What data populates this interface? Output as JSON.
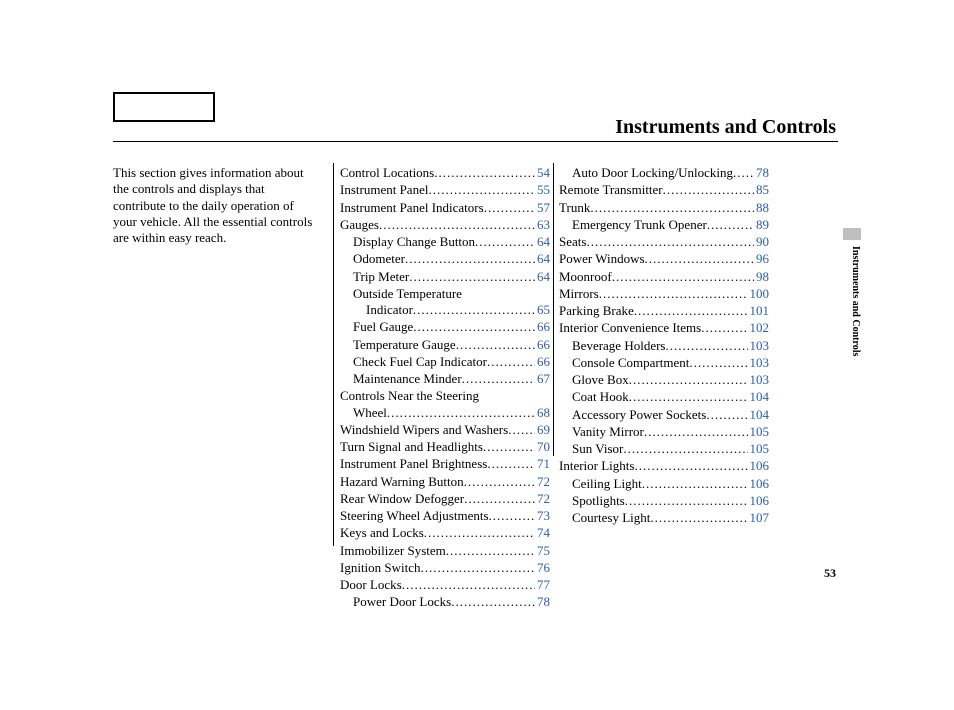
{
  "title": "Instruments and Controls",
  "intro": "This section gives information about the controls and displays that contribute to the daily operation of your vehicle. All the essential controls are within easy reach.",
  "side_tab": "Instruments and Controls",
  "page_number": "53",
  "col1": [
    {
      "label": "Control Locations",
      "page": "54",
      "indent": 0
    },
    {
      "label": "Instrument Panel",
      "page": "55",
      "indent": 0
    },
    {
      "label": "Instrument Panel Indicators",
      "page": "57",
      "indent": 0
    },
    {
      "label": "Gauges",
      "page": "63",
      "indent": 0
    },
    {
      "label": "Display Change Button",
      "page": "64",
      "indent": 1
    },
    {
      "label": "Odometer",
      "page": "64",
      "indent": 1
    },
    {
      "label": "Trip Meter",
      "page": "64",
      "indent": 1
    },
    {
      "label": "Outside Temperature",
      "wrap": "Indicator",
      "page": "65",
      "indent": 1
    },
    {
      "label": "Fuel Gauge",
      "page": "66",
      "indent": 1
    },
    {
      "label": "Temperature Gauge",
      "page": "66",
      "indent": 1
    },
    {
      "label": "Check Fuel Cap Indicator",
      "page": "66",
      "indent": 1
    },
    {
      "label": "Maintenance Minder",
      "page": "67",
      "indent": 1
    },
    {
      "label": "Controls Near the Steering",
      "wrap": "Wheel",
      "page": "68",
      "indent": 0
    },
    {
      "label": "Windshield Wipers and Washers",
      "page": "69",
      "indent": 0
    },
    {
      "label": "Turn Signal and Headlights",
      "page": "70",
      "indent": 0
    },
    {
      "label": "Instrument Panel Brightness",
      "page": "71",
      "indent": 0
    },
    {
      "label": "Hazard Warning Button",
      "page": "72",
      "indent": 0
    },
    {
      "label": "Rear Window Defogger",
      "page": "72",
      "indent": 0
    },
    {
      "label": "Steering Wheel Adjustments",
      "page": "73",
      "indent": 0
    },
    {
      "label": "Keys and Locks",
      "page": "74",
      "indent": 0
    },
    {
      "label": "Immobilizer System",
      "page": "75",
      "indent": 0
    },
    {
      "label": "Ignition Switch",
      "page": "76",
      "indent": 0
    },
    {
      "label": "Door Locks",
      "page": "77",
      "indent": 0
    },
    {
      "label": "Power Door Locks",
      "page": "78",
      "indent": 1
    }
  ],
  "col2": [
    {
      "label": "Auto Door Locking/Unlocking",
      "page": "78",
      "indent": 1
    },
    {
      "label": "Remote Transmitter",
      "page": "85",
      "indent": 0
    },
    {
      "label": "Trunk",
      "page": "88",
      "indent": 0
    },
    {
      "label": "Emergency Trunk Opener",
      "page": "89",
      "indent": 1
    },
    {
      "label": "Seats",
      "page": "90",
      "indent": 0
    },
    {
      "label": "Power Windows",
      "page": "96",
      "indent": 0
    },
    {
      "label": "Moonroof",
      "page": "98",
      "indent": 0
    },
    {
      "label": "Mirrors",
      "page": "100",
      "indent": 0
    },
    {
      "label": "Parking Brake",
      "page": "101",
      "indent": 0
    },
    {
      "label": "Interior Convenience Items",
      "page": "102",
      "indent": 0
    },
    {
      "label": "Beverage Holders",
      "page": "103",
      "indent": 1
    },
    {
      "label": "Console Compartment",
      "page": "103",
      "indent": 1
    },
    {
      "label": "Glove Box",
      "page": "103",
      "indent": 1
    },
    {
      "label": "Coat Hook",
      "page": "104",
      "indent": 1
    },
    {
      "label": "Accessory Power Sockets",
      "page": "104",
      "indent": 1
    },
    {
      "label": "Vanity Mirror",
      "page": "105",
      "indent": 1
    },
    {
      "label": "Sun Visor",
      "page": "105",
      "indent": 1
    },
    {
      "label": "Interior Lights",
      "page": "106",
      "indent": 0
    },
    {
      "label": "Ceiling Light",
      "page": "106",
      "indent": 1
    },
    {
      "label": "Spotlights",
      "page": "106",
      "indent": 1
    },
    {
      "label": "Courtesy Light",
      "page": "107",
      "indent": 1
    }
  ]
}
